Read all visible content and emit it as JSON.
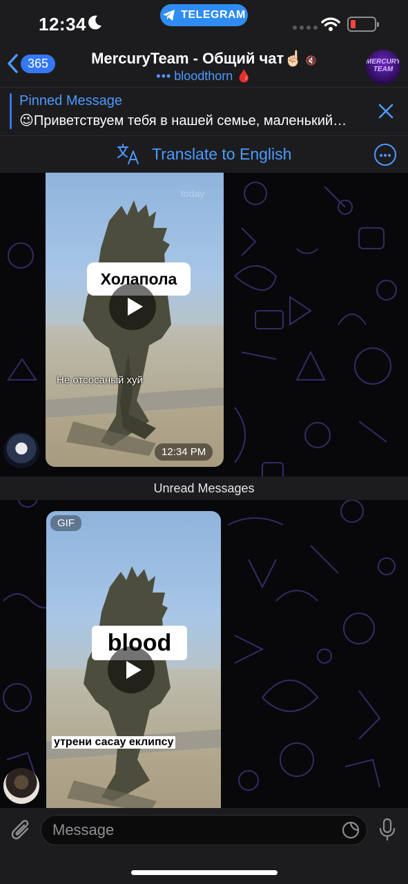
{
  "status_bar": {
    "time": "12:34",
    "telegram_label": "TELEGRAM",
    "battery_color": "#ff453a"
  },
  "header": {
    "back_count": "365",
    "title": "MercuryTeam - Общий чат☝🏻",
    "subtitle": "bloodthorn",
    "avatar_text": "MERCURY TEAM"
  },
  "pinned": {
    "label": "Pinned Message",
    "text": "😉Приветствуем тебя в нашей семье, маленький…"
  },
  "translate": {
    "label": "Translate to English"
  },
  "messages": [
    {
      "type": "video",
      "caption": "Холапола",
      "subtitle_text": "Не отсосаный хуй",
      "timestamp": "12:34 PM",
      "watermark": "today"
    },
    {
      "type": "gif",
      "badge": "GIF",
      "caption": "blood",
      "subtitle_text": "утрени сасау еклипсу"
    }
  ],
  "unread_label": "Unread Messages",
  "input": {
    "placeholder": "Message"
  },
  "colors": {
    "accent": "#4c9bff",
    "telegram_pill": "#2f8cf2",
    "background": "#08080b",
    "panel": "#1c1c1e"
  }
}
